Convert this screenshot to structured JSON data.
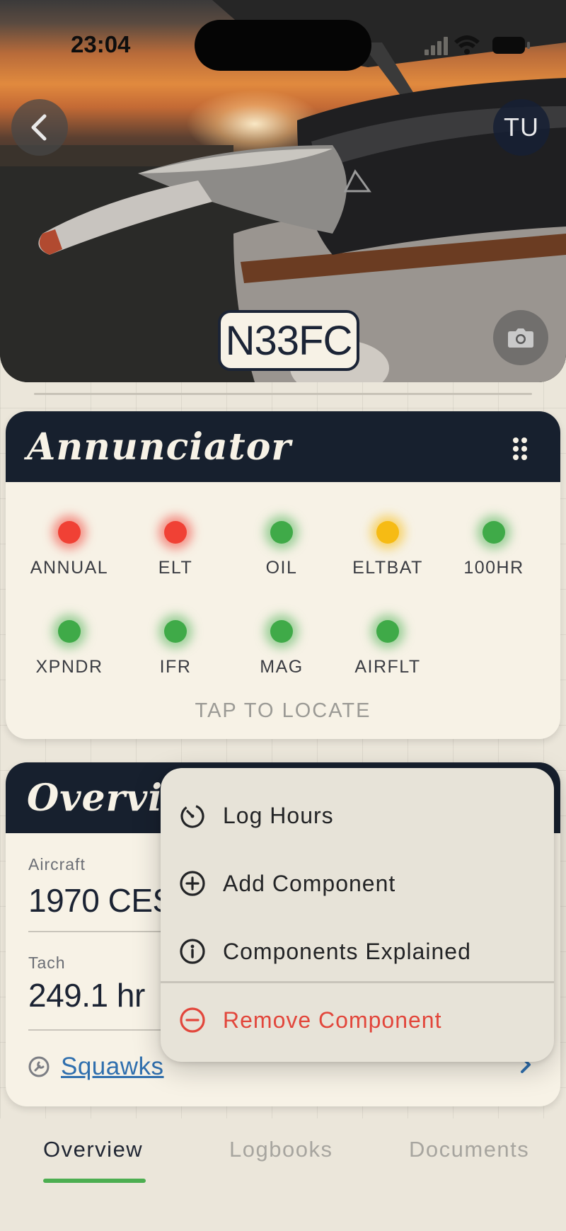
{
  "status_bar": {
    "time": "23:04"
  },
  "header": {
    "tail_number": "N33FC",
    "avatar_initials": "TU"
  },
  "annunciator": {
    "title": "Annunciator",
    "lights": [
      {
        "label": "ANNUAL",
        "status": "red"
      },
      {
        "label": "ELT",
        "status": "red"
      },
      {
        "label": "OIL",
        "status": "green"
      },
      {
        "label": "ELTBAT",
        "status": "yellow"
      },
      {
        "label": "100HR",
        "status": "green"
      },
      {
        "label": "XPNDR",
        "status": "green"
      },
      {
        "label": "IFR",
        "status": "green"
      },
      {
        "label": "MAG",
        "status": "green"
      },
      {
        "label": "AIRFLT",
        "status": "green"
      }
    ],
    "hint": "TAP TO LOCATE"
  },
  "overview": {
    "title": "Overvi",
    "aircraft_label": "Aircraft",
    "aircraft_value": "1970 CES",
    "tach_label": "Tach",
    "tach_value": "249.1 hr",
    "squawks_label": "Squawks"
  },
  "context_menu": {
    "items": [
      {
        "label": "Log Hours",
        "icon": "timer-icon"
      },
      {
        "label": "Add Component",
        "icon": "plus-circle-icon"
      },
      {
        "label": "Components Explained",
        "icon": "info-circle-icon"
      },
      {
        "label": "Remove Component",
        "icon": "minus-circle-icon",
        "destructive": true
      }
    ]
  },
  "tabs": [
    {
      "label": "Overview",
      "active": true
    },
    {
      "label": "Logbooks",
      "active": false
    },
    {
      "label": "Documents",
      "active": false
    }
  ],
  "colors": {
    "header_dark": "#17202e",
    "card_bg": "#f7f2e6",
    "status_red": "#f04135",
    "status_green": "#3faa48",
    "status_yellow": "#f6bb14",
    "link_blue": "#2f6fae",
    "destructive_red": "#e2463b",
    "tab_indicator": "#4cae50"
  }
}
